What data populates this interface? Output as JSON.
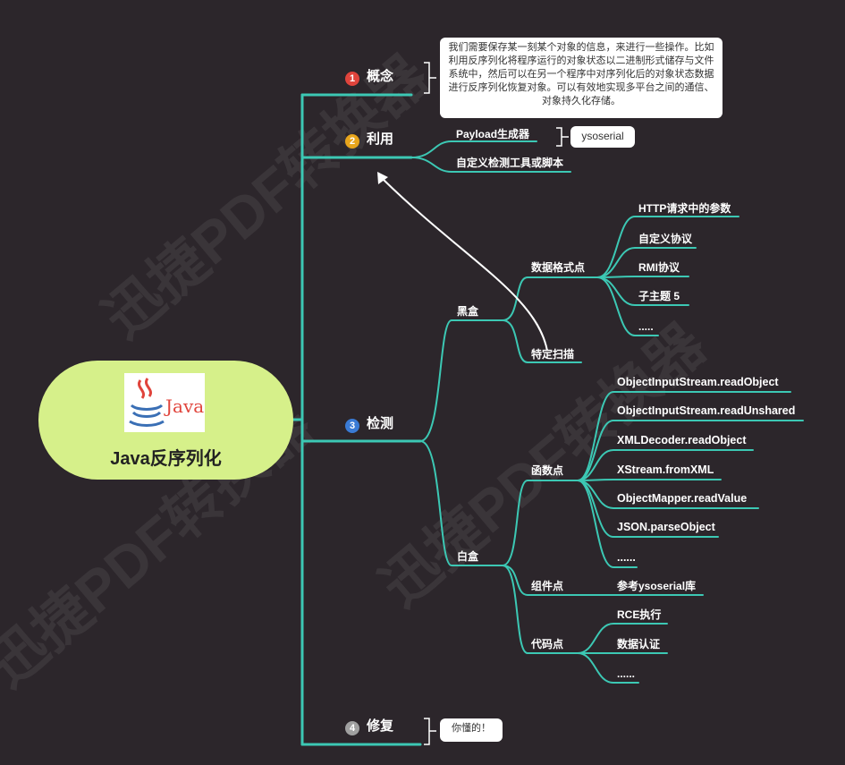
{
  "root": {
    "title": "Java反序列化",
    "logo_text": "Java"
  },
  "colors": {
    "line": "#3cc8b4",
    "root_bg": "#d6f08a",
    "badge1": "#e0443c",
    "badge2": "#e8a51c",
    "badge3": "#3a7bd5",
    "badge4": "#a0a0a0"
  },
  "branches": {
    "concept": {
      "num": "1",
      "label": "概念",
      "note": "我们需要保存某一刻某个对象的信息，来进行一些操作。比如利用反序列化将程序运行的对象状态以二进制形式储存与文件系统中，然后可以在另一个程序中对序列化后的对象状态数据进行反序列化恢复对象。可以有效地实现多平台之间的通信、对象持久化存储。"
    },
    "exploit": {
      "num": "2",
      "label": "利用",
      "payload": "Payload生成器",
      "ysoserial": "ysoserial",
      "custom": "自定义检测工具或脚本"
    },
    "detect": {
      "num": "3",
      "label": "检测",
      "blackbox": {
        "label": "黑盒",
        "format": {
          "label": "数据格式点",
          "items": [
            "HTTP请求中的参数",
            "自定义协议",
            "RMI协议",
            "子主题 5",
            "....."
          ]
        },
        "scan": "特定扫描"
      },
      "whitebox": {
        "label": "白盒",
        "func": {
          "label": "函数点",
          "items": [
            "ObjectInputStream.readObject",
            "ObjectInputStream.readUnshared",
            "XMLDecoder.readObject",
            "XStream.fromXML",
            "ObjectMapper.readValue",
            "JSON.parseObject",
            "......"
          ]
        },
        "component": {
          "label": "组件点",
          "item": "参考ysoserial库"
        },
        "code": {
          "label": "代码点",
          "items": [
            "RCE执行",
            "数据认证",
            "......"
          ]
        }
      }
    },
    "fix": {
      "num": "4",
      "label": "修复",
      "note": "你懂的！"
    }
  }
}
